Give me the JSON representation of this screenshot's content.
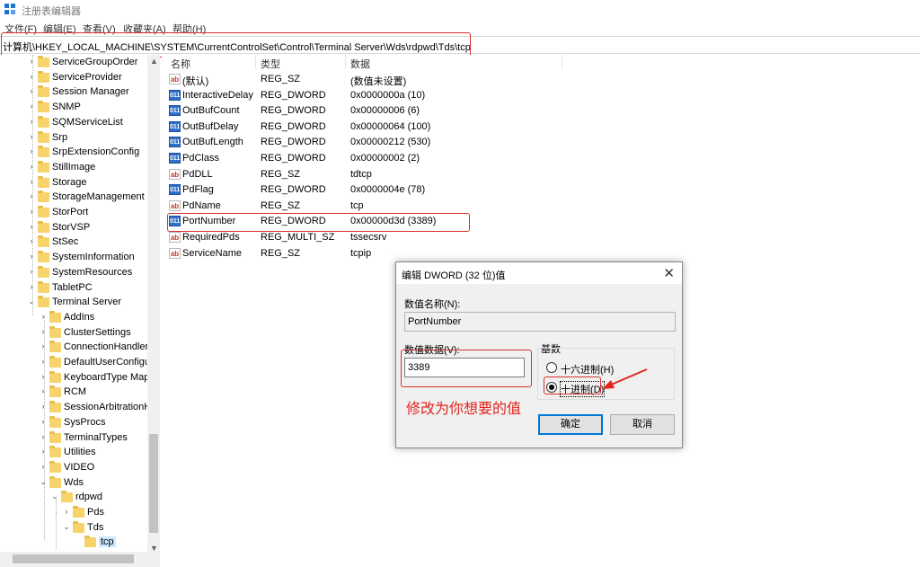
{
  "window": {
    "title": "注册表编辑器",
    "icon": "registry-editor-icon"
  },
  "menu": [
    "文件(F)",
    "编辑(E)",
    "查看(V)",
    "收藏夹(A)",
    "帮助(H)"
  ],
  "address": "计算机\\HKEY_LOCAL_MACHINE\\SYSTEM\\CurrentControlSet\\Control\\Terminal Server\\Wds\\rdpwd\\Tds\\tcp",
  "tree": [
    "ServiceGroupOrder",
    "ServiceProvider",
    "Session Manager",
    "SNMP",
    "SQMServiceList",
    "Srp",
    "SrpExtensionConfig",
    "StillImage",
    "Storage",
    "StorageManagement",
    "StorPort",
    "StorVSP",
    "StSec",
    "SystemInformation",
    "SystemResources",
    "TabletPC",
    "Terminal Server",
    "AddIns",
    "ClusterSettings",
    "ConnectionHandler",
    "DefaultUserConfigu",
    "KeyboardType Map",
    "RCM",
    "SessionArbitrationH",
    "SysProcs",
    "TerminalTypes",
    "Utilities",
    "VIDEO",
    "Wds",
    "rdpwd",
    "Pds",
    "Tds",
    "tcp"
  ],
  "list": {
    "headers": [
      "名称",
      "类型",
      "数据"
    ],
    "rows": [
      {
        "name": "(默认)",
        "type": "REG_SZ",
        "data": "(数值未设置)",
        "icon": "string-value-icon"
      },
      {
        "name": "InteractiveDelay",
        "type": "REG_DWORD",
        "data": "0x0000000a (10)",
        "icon": "dword-value-icon"
      },
      {
        "name": "OutBufCount",
        "type": "REG_DWORD",
        "data": "0x00000006 (6)",
        "icon": "dword-value-icon"
      },
      {
        "name": "OutBufDelay",
        "type": "REG_DWORD",
        "data": "0x00000064 (100)",
        "icon": "dword-value-icon"
      },
      {
        "name": "OutBufLength",
        "type": "REG_DWORD",
        "data": "0x00000212 (530)",
        "icon": "dword-value-icon"
      },
      {
        "name": "PdClass",
        "type": "REG_DWORD",
        "data": "0x00000002 (2)",
        "icon": "dword-value-icon"
      },
      {
        "name": "PdDLL",
        "type": "REG_SZ",
        "data": "tdtcp",
        "icon": "string-value-icon"
      },
      {
        "name": "PdFlag",
        "type": "REG_DWORD",
        "data": "0x0000004e (78)",
        "icon": "dword-value-icon"
      },
      {
        "name": "PdName",
        "type": "REG_SZ",
        "data": "tcp",
        "icon": "string-value-icon"
      },
      {
        "name": "PortNumber",
        "type": "REG_DWORD",
        "data": "0x00000d3d (3389)",
        "icon": "dword-value-icon"
      },
      {
        "name": "RequiredPds",
        "type": "REG_MULTI_SZ",
        "data": "tssecsrv",
        "icon": "string-value-icon"
      },
      {
        "name": "ServiceName",
        "type": "REG_SZ",
        "data": "tcpip",
        "icon": "string-value-icon"
      }
    ]
  },
  "dialog": {
    "title": "编辑 DWORD (32 位)值",
    "name_label": "数值名称(N):",
    "name_value": "PortNumber",
    "data_label": "数值数据(V):",
    "data_value": "3389",
    "base_label": "基数",
    "hex_label": "十六进制(H)",
    "dec_label": "十进制(D)",
    "selected_base": "decimal",
    "ok": "确定",
    "cancel": "取消"
  },
  "annotation": "修改为你想要的值",
  "colors": {
    "highlight": "#d9302c",
    "annotation": "#e0261f",
    "accent": "#0078d7"
  }
}
